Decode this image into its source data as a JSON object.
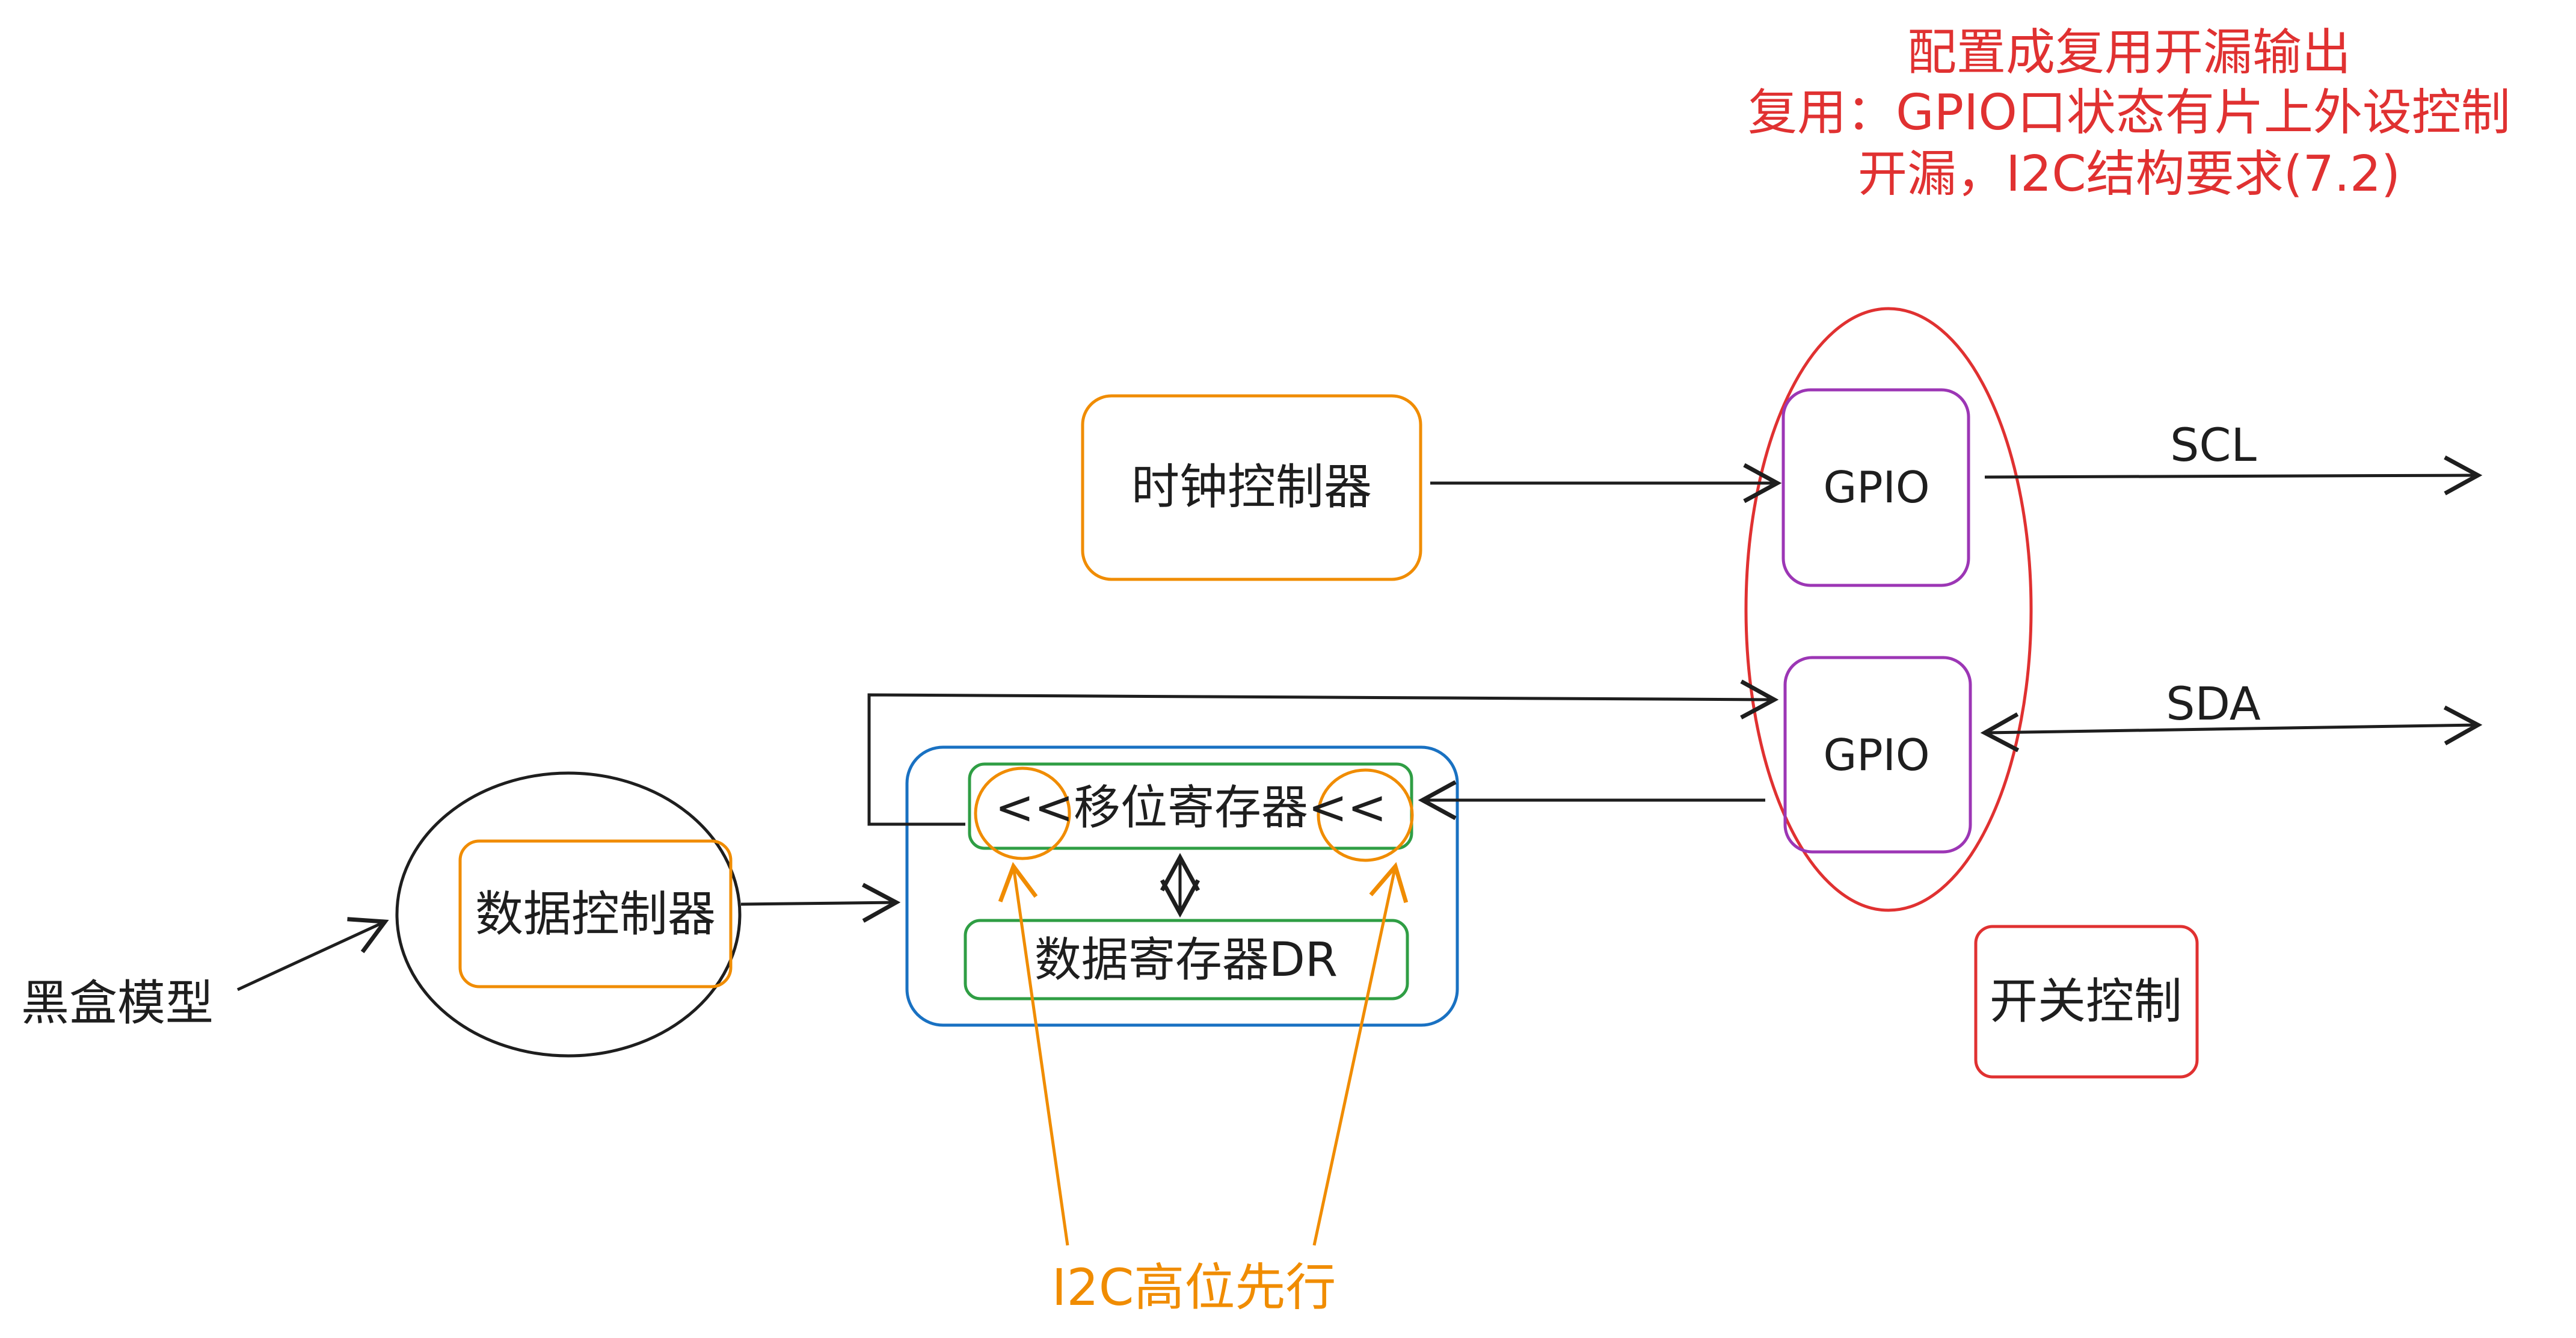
{
  "note": {
    "lines": [
      "配置成复用开漏输出",
      "复用：GPIO口状态有片上外设控制",
      "开漏，I2C结构要求(7.2)"
    ]
  },
  "blocks": {
    "clock_controller": "时钟控制器",
    "data_controller": "数据控制器",
    "black_box": "黑盒模型",
    "shift_register": "<<移位寄存器<<",
    "data_register": "数据寄存器DR",
    "gpio_scl": "GPIO",
    "gpio_sda": "GPIO",
    "switch_control": "开关控制"
  },
  "signals": {
    "scl": "SCL",
    "sda": "SDA"
  },
  "annotation": {
    "msb_first": "I2C高位先行"
  },
  "colors": {
    "note": "#e03131",
    "clock_box": "#f08c00",
    "purple_box": "#9c36b5",
    "green_box": "#2f9e44",
    "blue_box": "#1971c2",
    "red": "#e03131",
    "orange": "#f08c00",
    "ink": "#1e1e1e"
  }
}
